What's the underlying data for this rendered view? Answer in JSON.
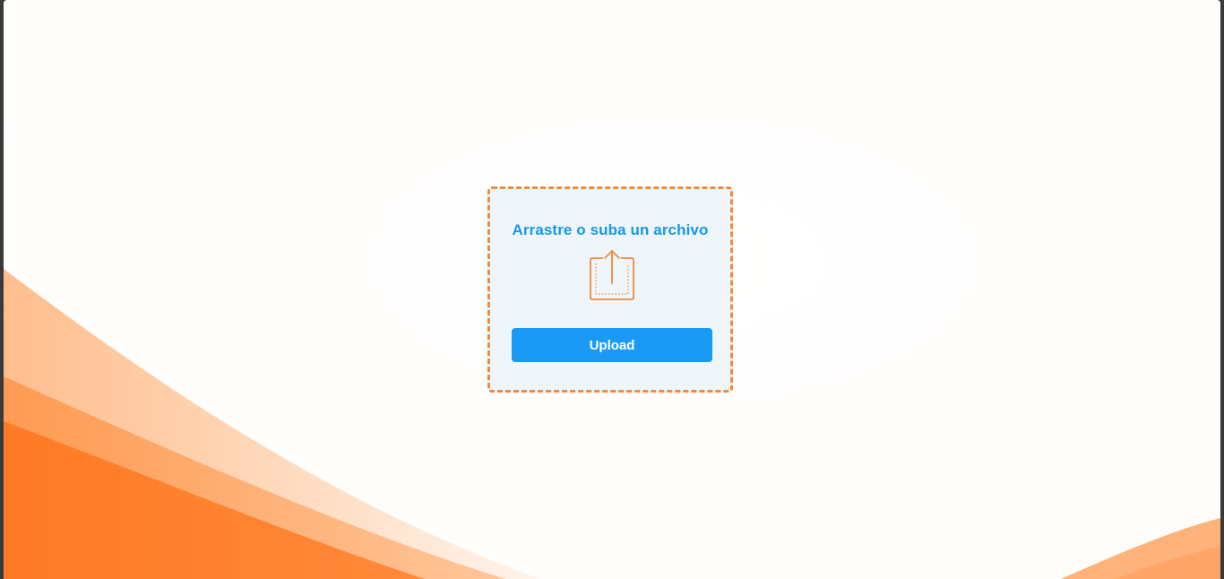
{
  "upload_panel": {
    "title": "Arrastre o suba un archivo",
    "icon": "upload-icon",
    "button_label": "Upload"
  },
  "colors": {
    "accent_blue": "#1b9af5",
    "title_blue": "#1a96ea",
    "dashed_border_orange": "#ef8a3e",
    "panel_background": "#eef6fc",
    "wave_orange": "#ff7f2a"
  }
}
